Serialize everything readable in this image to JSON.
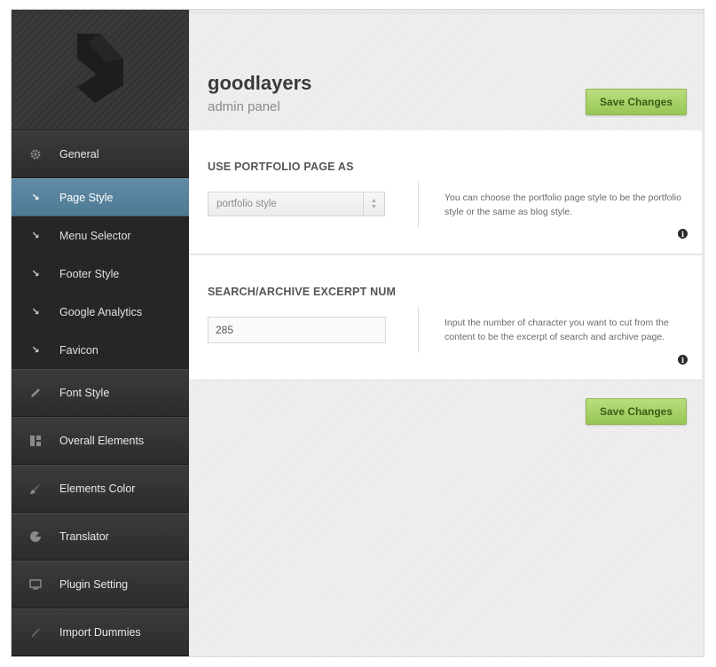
{
  "brand": {
    "title": "goodlayers",
    "subtitle": "admin panel"
  },
  "sidebar": {
    "general": {
      "label": "General"
    },
    "subitems": [
      {
        "label": "Page Style"
      },
      {
        "label": "Menu Selector"
      },
      {
        "label": "Footer Style"
      },
      {
        "label": "Google Analytics"
      },
      {
        "label": "Favicon"
      }
    ],
    "sections": [
      {
        "label": "Font Style",
        "icon": "pencil-icon"
      },
      {
        "label": "Overall Elements",
        "icon": "layout-icon"
      },
      {
        "label": "Elements Color",
        "icon": "brush-icon"
      },
      {
        "label": "Translator",
        "icon": "translator-icon"
      },
      {
        "label": "Plugin Setting",
        "icon": "monitor-icon"
      },
      {
        "label": "Import Dummies",
        "icon": "slash-icon"
      }
    ]
  },
  "actions": {
    "save_label": "Save Changes"
  },
  "options": [
    {
      "title": "USE PORTFOLIO PAGE AS",
      "value": "portfolio style",
      "description": "You can choose the portfolio page style to be the portfolio style or the same as blog style."
    },
    {
      "title": "SEARCH/ARCHIVE EXCERPT NUM",
      "value": "285",
      "description": "Input the number of character you want to cut from the content to be the excerpt of search and archive page."
    }
  ],
  "colors": {
    "accent_active": "#5a87a2",
    "save_green": "#a6d165",
    "sidebar": "#2f2f2f"
  }
}
